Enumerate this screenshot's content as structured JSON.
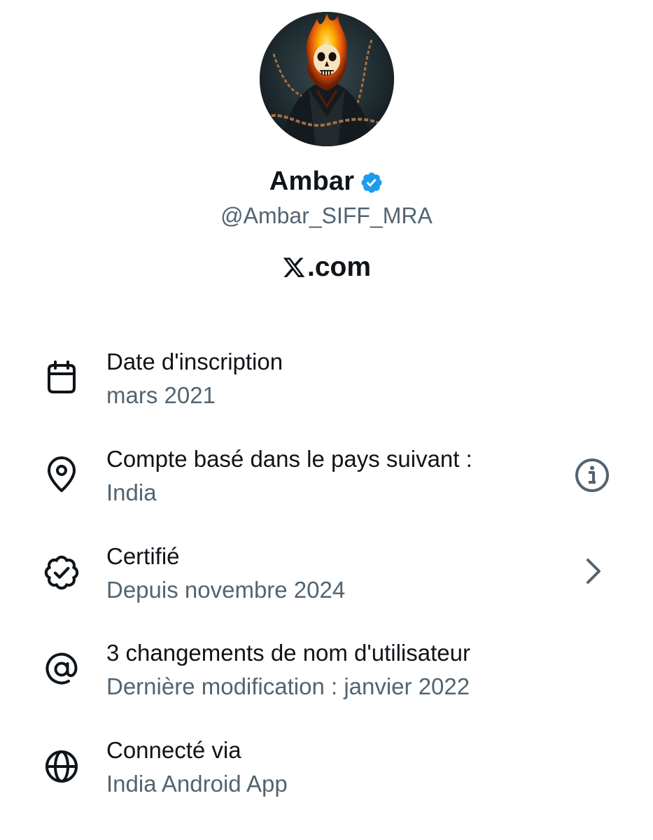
{
  "profile": {
    "display_name": "Ambar",
    "handle": "@Ambar_SIFF_MRA",
    "verified": true,
    "avatar": "ghost-rider-avatar"
  },
  "brand": {
    "icon": "x-logo-icon",
    "text": ".com"
  },
  "colors": {
    "primary_text": "#0f1419",
    "secondary_text": "#536471",
    "verified_blue": "#1d9bf0",
    "background": "#ffffff"
  },
  "info": [
    {
      "icon": "calendar-icon",
      "title": "Date d'inscription",
      "subtitle": "mars 2021"
    },
    {
      "icon": "location-pin-icon",
      "title": "Compte basé dans le pays suivant :",
      "subtitle": "India",
      "action_icon": "info-icon"
    },
    {
      "icon": "verified-badge-icon",
      "title": "Certifié",
      "subtitle": "Depuis novembre 2024",
      "action_icon": "chevron-right-icon"
    },
    {
      "icon": "at-sign-icon",
      "title": "3 changements de nom d'utilisateur",
      "subtitle": "Dernière modification : janvier 2022"
    },
    {
      "icon": "globe-icon",
      "title": "Connecté via",
      "subtitle": "India Android App"
    }
  ]
}
